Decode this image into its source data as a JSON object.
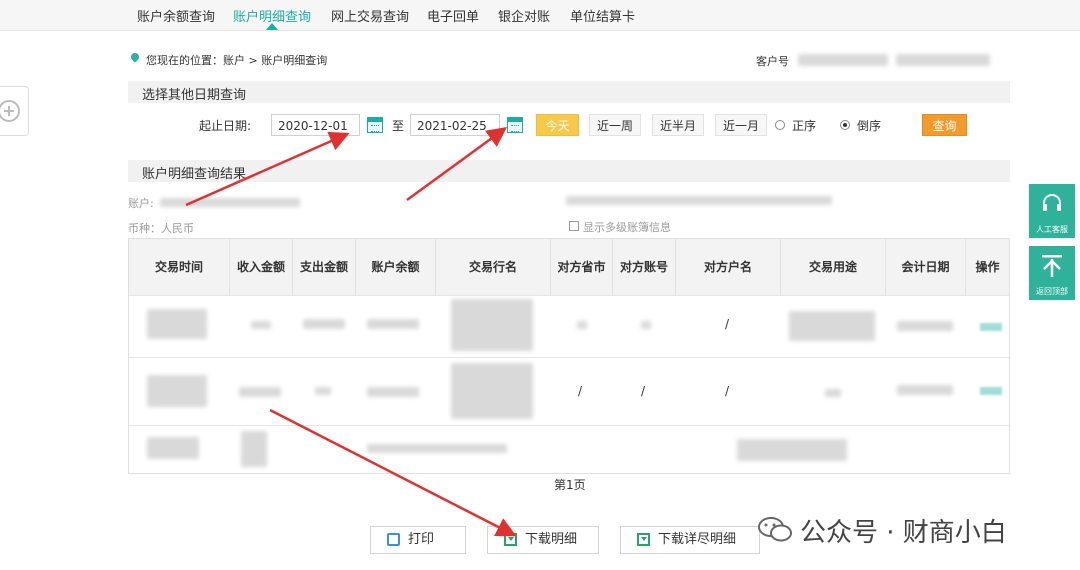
{
  "nav": {
    "items": [
      "账户余额查询",
      "账户明细查询",
      "网上交易查询",
      "电子回单",
      "银企对账",
      "单位结算卡"
    ],
    "active_index": 1
  },
  "breadcrumb": "您现在的位置：账户 > 账户明细查询",
  "customer_label": "客户号",
  "date_section": {
    "title": "选择其他日期查询",
    "range_label": "起止日期:",
    "start_date": "2020-12-01",
    "to_label": "至",
    "end_date": "2021-02-25",
    "quick": {
      "today": "今天",
      "week": "近一周",
      "half_month": "近半月",
      "month": "近一月"
    },
    "order_asc": "正序",
    "order_desc": "倒序",
    "order_selected": "倒序",
    "search": "查询"
  },
  "result_section": {
    "title": "账户明细查询结果",
    "account_label": "账户:",
    "currency": "币种：人民币",
    "multi_level": "显示多级账簿信息"
  },
  "table": {
    "headers": [
      "交易时间",
      "收入金额",
      "支出金额",
      "账户余额",
      "交易行名",
      "对方省市",
      "对方账号",
      "对方户名",
      "交易用途",
      "会计日期",
      "操作"
    ],
    "row2_slashes": [
      "/",
      "/",
      "/"
    ]
  },
  "row1": {
    "slash": "/"
  },
  "pager": "第1页",
  "buttons": {
    "print": "打印",
    "download": "下载明细",
    "download_full": "下载详尽明细"
  },
  "right_floats": {
    "service": "人工客服",
    "top": "返回顶部"
  },
  "watermark": "公众号 · 财商小白",
  "colors": {
    "accent": "#1aaea3",
    "today": "#f6c94a",
    "search": "#f39a2c",
    "annotation": "#e03131"
  }
}
